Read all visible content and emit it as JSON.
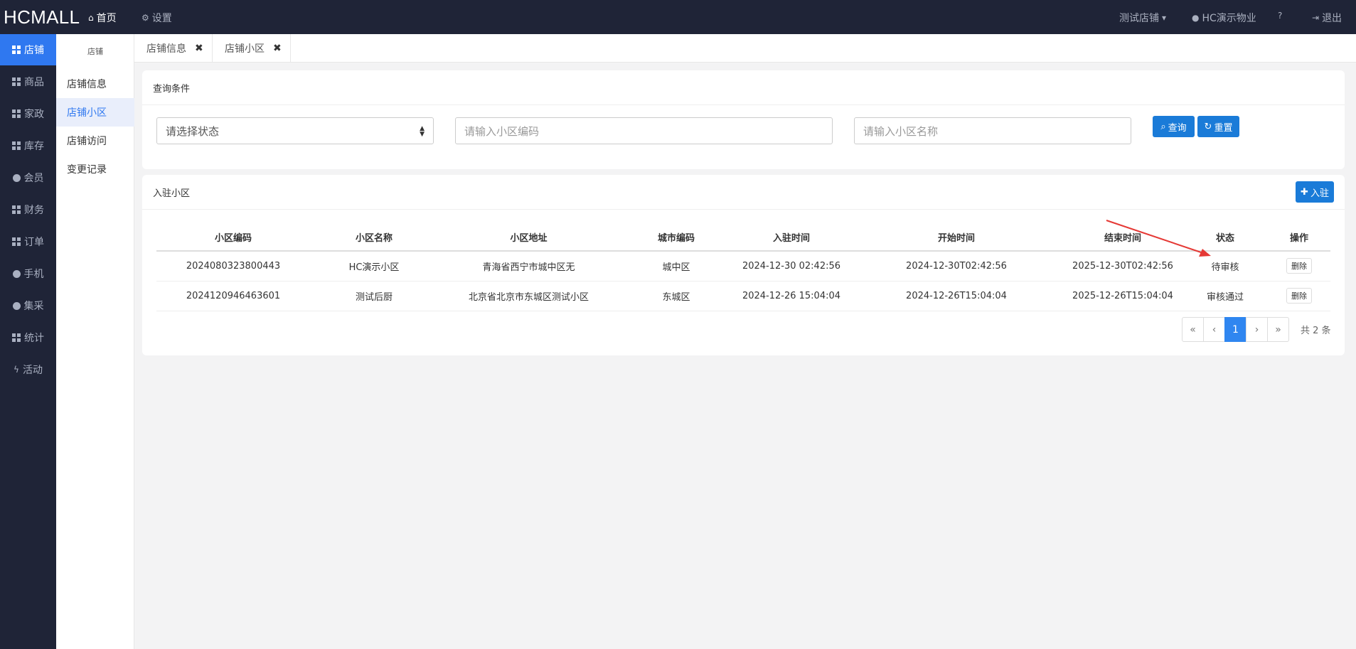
{
  "brand": "HCMALL",
  "topnav": {
    "home": "首页",
    "settings": "设置",
    "store": "测试店铺",
    "property": "HC演示物业",
    "logout": "退出"
  },
  "mainmenu": [
    {
      "label": "店铺",
      "icon": "grid-icon"
    },
    {
      "label": "商品",
      "icon": "grid-icon"
    },
    {
      "label": "家政",
      "icon": "grid-icon"
    },
    {
      "label": "库存",
      "icon": "grid-icon"
    },
    {
      "label": "会员",
      "icon": "globe-icon"
    },
    {
      "label": "财务",
      "icon": "grid-icon"
    },
    {
      "label": "订单",
      "icon": "grid-icon"
    },
    {
      "label": "手机",
      "icon": "globe-icon"
    },
    {
      "label": "集采",
      "icon": "globe-icon"
    },
    {
      "label": "统计",
      "icon": "grid-icon"
    },
    {
      "label": "活动",
      "icon": "bolt-icon"
    }
  ],
  "submenu": {
    "title": "店铺",
    "items": [
      "店铺信息",
      "店铺小区",
      "店铺访问",
      "变更记录"
    ]
  },
  "tabs": [
    {
      "label": "店铺信息"
    },
    {
      "label": "店铺小区"
    }
  ],
  "query": {
    "title": "查询条件",
    "status_placeholder": "请选择状态",
    "code_placeholder": "请输入小区编码",
    "name_placeholder": "请输入小区名称",
    "search_label": "查询",
    "reset_label": "重置"
  },
  "list": {
    "title": "入驻小区",
    "add_label": "入驻",
    "columns": [
      "小区编码",
      "小区名称",
      "小区地址",
      "城市编码",
      "入驻时间",
      "开始时间",
      "结束时间",
      "状态",
      "操作"
    ],
    "rows": [
      {
        "code": "2024080323800443",
        "name": "HC演示小区",
        "address": "青海省西宁市城中区无",
        "city": "城中区",
        "joined": "2024-12-30 02:42:56",
        "start": "2024-12-30T02:42:56",
        "end": "2025-12-30T02:42:56",
        "status": "待审核",
        "action": "删除"
      },
      {
        "code": "2024120946463601",
        "name": "测试后厨",
        "address": "北京省北京市东城区测试小区",
        "city": "东城区",
        "joined": "2024-12-26 15:04:04",
        "start": "2024-12-26T15:04:04",
        "end": "2025-12-26T15:04:04",
        "status": "审核通过",
        "action": "删除"
      }
    ],
    "pager": {
      "first": "«",
      "prev": "‹",
      "current": "1",
      "next": "›",
      "last": "»",
      "total": "共 2 条"
    }
  },
  "colors": {
    "accent": "#2f78f0",
    "navbar": "#1f2437",
    "annotation": "#e53935"
  }
}
